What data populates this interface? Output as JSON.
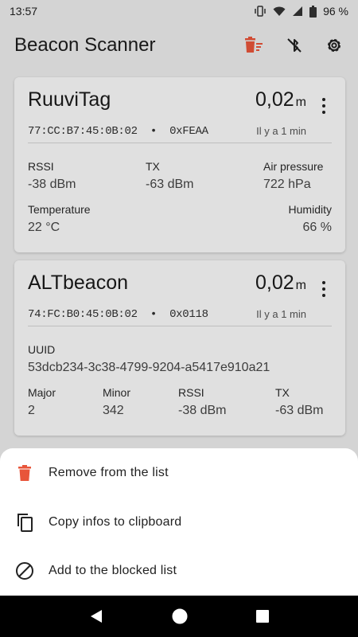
{
  "status": {
    "time": "13:57",
    "battery": "96 %"
  },
  "app": {
    "title": "Beacon Scanner",
    "accent": "#e8553a"
  },
  "beacons": [
    {
      "name": "RuuviTag",
      "address": "77:CC:B7:45:0B:02",
      "separator": "•",
      "code": "0xFEAA",
      "distance": "0,02",
      "unit": "m",
      "lastseen": "Il y a 1 min",
      "fields": {
        "rssi_label": "RSSI",
        "rssi_value": "-38 dBm",
        "tx_label": "TX",
        "tx_value": "-63 dBm",
        "pressure_label": "Air pressure",
        "pressure_value": "722 hPa",
        "temp_label": "Temperature",
        "temp_value": "22 °C",
        "humidity_label": "Humidity",
        "humidity_value": "66 %"
      }
    },
    {
      "name": "ALTbeacon",
      "address": "74:FC:B0:45:0B:02",
      "separator": "•",
      "code": "0x0118",
      "distance": "0,02",
      "unit": "m",
      "lastseen": "Il y a 1 min",
      "fields": {
        "uuid_label": "UUID",
        "uuid_value": "53dcb234-3c38-4799-9204-a5417e910a21",
        "major_label": "Major",
        "major_value": "2",
        "minor_label": "Minor",
        "minor_value": "342",
        "rssi_label": "RSSI",
        "rssi_value": "-38 dBm",
        "tx_label": "TX",
        "tx_value": "-63 dBm"
      }
    }
  ],
  "sheet": {
    "items": [
      {
        "label": "Remove from the list",
        "icon": "trash-icon"
      },
      {
        "label": "Copy infos to clipboard",
        "icon": "copy-icon"
      },
      {
        "label": "Add to the blocked list",
        "icon": "block-icon"
      }
    ]
  },
  "icons": {
    "appbar": [
      "clear-list-icon",
      "bluetooth-off-icon",
      "settings-icon"
    ],
    "navbar": [
      "back-icon",
      "home-icon",
      "recents-icon"
    ]
  }
}
